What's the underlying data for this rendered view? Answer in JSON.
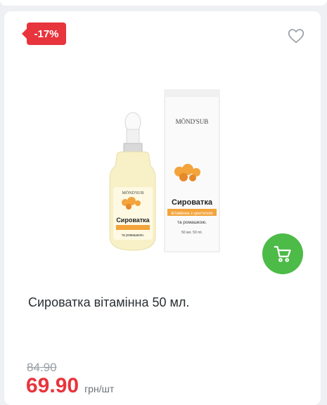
{
  "product": {
    "discount_badge": "-17%",
    "title": "Сироватка вітамінна 50 мл.",
    "old_price": "84.90",
    "new_price": "69.90",
    "unit": "грн/шт",
    "image": {
      "brand": "MÖND'SUB",
      "name": "Сироватка",
      "desc1": "вітамінна з центелою",
      "desc2": "та ромашкою.",
      "volume": "50 мл. 50 ml."
    }
  },
  "icons": {
    "favorite": "heart-icon",
    "cart": "cart-icon"
  },
  "colors": {
    "accent_red": "#e8343c",
    "cart_green": "#4cbb47"
  }
}
